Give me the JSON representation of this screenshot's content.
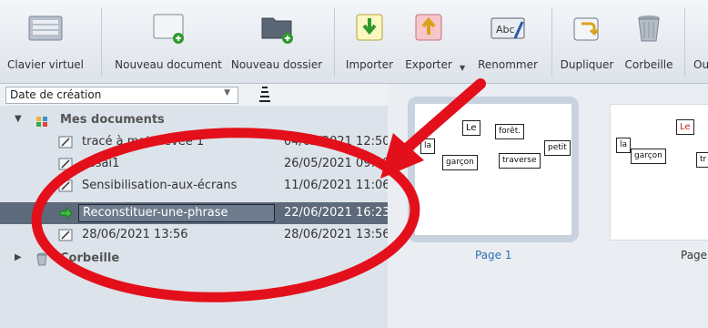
{
  "toolbar": {
    "buttons": [
      {
        "id": "virtual-keyboard",
        "label": "Clavier virtuel",
        "icon": "keyboard-icon"
      },
      {
        "id": "new-document",
        "label": "Nouveau document",
        "icon": "new-document-icon"
      },
      {
        "id": "new-folder",
        "label": "Nouveau dossier",
        "icon": "new-folder-icon"
      },
      {
        "id": "import",
        "label": "Importer",
        "icon": "import-icon"
      },
      {
        "id": "export",
        "label": "Exporter",
        "icon": "export-icon"
      },
      {
        "id": "rename",
        "label": "Renommer",
        "icon": "rename-icon"
      },
      {
        "id": "duplicate",
        "label": "Dupliquer",
        "icon": "duplicate-icon"
      },
      {
        "id": "trash",
        "label": "Corbeille",
        "icon": "trash-icon"
      },
      {
        "id": "more",
        "label": "Ou",
        "icon": "more-icon"
      }
    ]
  },
  "sort": {
    "selected": "Date de création",
    "arrow": "▼"
  },
  "tree": {
    "root_label": "Mes documents",
    "trash_label": "Corbeille",
    "items": [
      {
        "name": "tracé à main levée 1",
        "date": "04/02/2021 12:50",
        "icon": "pencil-doc-icon"
      },
      {
        "name": "essai1",
        "date": "26/05/2021 09:39",
        "icon": "pencil-doc-icon"
      },
      {
        "name": "Sensibilisation-aux-écrans",
        "date": "11/06/2021 11:06",
        "icon": "pencil-doc-icon"
      },
      {
        "name": "Reconstituer-une-phrase",
        "date": "22/06/2021 16:23",
        "icon": "green-arrow-icon",
        "selected": true
      },
      {
        "name": "28/06/2021 13:56",
        "date": "28/06/2021 13:56",
        "icon": "pencil-doc-icon"
      }
    ],
    "expand_open": "▼",
    "expand_closed": "▶"
  },
  "preview": {
    "page1": {
      "label": "Page 1",
      "words": [
        "Le",
        "forêt.",
        "la",
        "petit",
        "garçon",
        "traverse"
      ]
    },
    "page2": {
      "label": "Page",
      "words": [
        "Le",
        "la",
        "garçon",
        "tr"
      ]
    }
  },
  "colors": {
    "annotation_red": "#e3101b",
    "selection_bg": "#5c6a7c",
    "page_label_blue": "#2f6fb3"
  }
}
